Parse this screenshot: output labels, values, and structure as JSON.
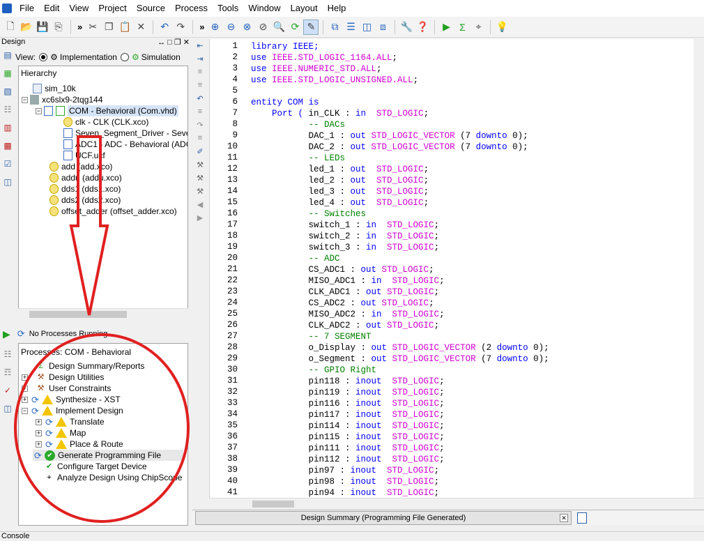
{
  "menu": [
    "File",
    "Edit",
    "View",
    "Project",
    "Source",
    "Process",
    "Tools",
    "Window",
    "Layout",
    "Help"
  ],
  "design_header": "Design",
  "view": {
    "label": "View:",
    "implementation": "Implementation",
    "simulation": "Simulation"
  },
  "hierarchy": {
    "title": "Hierarchy",
    "items": [
      "sim_10k",
      "xc6slx9-2tqg144",
      "COM - Behavioral (Com.vhd)",
      "clk - CLK (CLK.xco)",
      "Seven_Segment_Driver - Sever",
      "ADC1 - ADC - Behavioral (ADC",
      "UCF.ucf",
      "add (add.xco)",
      "addu (addu.xco)",
      "dds1 (dds1.xco)",
      "dds2 (dds2.xco)",
      "offset_adder (offset_adder.xco)"
    ]
  },
  "process_status": "No Processes Running",
  "processes": {
    "title": "Processes: COM - Behavioral",
    "items": [
      "Design Summary/Reports",
      "Design Utilities",
      "User Constraints",
      "Synthesize - XST",
      "Implement Design",
      "Translate",
      "Map",
      "Place & Route",
      "Generate Programming File",
      "Configure Target Device",
      "Analyze Design Using ChipScope"
    ]
  },
  "code_lines": [
    [
      {
        "t": "library IEEE;",
        "c": "kw"
      }
    ],
    [
      {
        "t": "use ",
        "c": "kw"
      },
      {
        "t": "IEEE.STD_LOGIC_1164.ALL",
        "c": "ty"
      },
      {
        "t": ";",
        "c": "tx"
      }
    ],
    [
      {
        "t": "use ",
        "c": "kw"
      },
      {
        "t": "IEEE.NUMERIC_STD.ALL",
        "c": "ty"
      },
      {
        "t": ";",
        "c": "tx"
      }
    ],
    [
      {
        "t": "use ",
        "c": "kw"
      },
      {
        "t": "IEEE.STD_LOGIC_UNSIGNED.ALL",
        "c": "ty"
      },
      {
        "t": ";",
        "c": "tx"
      }
    ],
    [
      {
        "t": "",
        "c": "tx"
      }
    ],
    [
      {
        "t": "entity COM is",
        "c": "kw"
      }
    ],
    [
      {
        "t": "    Port ( ",
        "c": "kw"
      },
      {
        "t": "in_CLK : ",
        "c": "tx"
      },
      {
        "t": "in  ",
        "c": "kw"
      },
      {
        "t": "STD_LOGIC",
        "c": "ty"
      },
      {
        "t": ";",
        "c": "tx"
      }
    ],
    [
      {
        "t": "           -- DACs",
        "c": "cm"
      }
    ],
    [
      {
        "t": "           DAC_1 : ",
        "c": "tx"
      },
      {
        "t": "out ",
        "c": "kw"
      },
      {
        "t": "STD_LOGIC_VECTOR ",
        "c": "ty"
      },
      {
        "t": "(7 ",
        "c": "tx"
      },
      {
        "t": "downto",
        "c": "kw"
      },
      {
        "t": " 0);",
        "c": "tx"
      }
    ],
    [
      {
        "t": "           DAC_2 : ",
        "c": "tx"
      },
      {
        "t": "out ",
        "c": "kw"
      },
      {
        "t": "STD_LOGIC_VECTOR ",
        "c": "ty"
      },
      {
        "t": "(7 ",
        "c": "tx"
      },
      {
        "t": "downto",
        "c": "kw"
      },
      {
        "t": " 0);",
        "c": "tx"
      }
    ],
    [
      {
        "t": "           -- LEDs",
        "c": "cm"
      }
    ],
    [
      {
        "t": "           led_1 : ",
        "c": "tx"
      },
      {
        "t": "out  ",
        "c": "kw"
      },
      {
        "t": "STD_LOGIC",
        "c": "ty"
      },
      {
        "t": ";",
        "c": "tx"
      }
    ],
    [
      {
        "t": "           led_2 : ",
        "c": "tx"
      },
      {
        "t": "out  ",
        "c": "kw"
      },
      {
        "t": "STD_LOGIC",
        "c": "ty"
      },
      {
        "t": ";",
        "c": "tx"
      }
    ],
    [
      {
        "t": "           led_3 : ",
        "c": "tx"
      },
      {
        "t": "out  ",
        "c": "kw"
      },
      {
        "t": "STD_LOGIC",
        "c": "ty"
      },
      {
        "t": ";",
        "c": "tx"
      }
    ],
    [
      {
        "t": "           led_4 : ",
        "c": "tx"
      },
      {
        "t": "out  ",
        "c": "kw"
      },
      {
        "t": "STD_LOGIC",
        "c": "ty"
      },
      {
        "t": ";",
        "c": "tx"
      }
    ],
    [
      {
        "t": "           -- Switches",
        "c": "cm"
      }
    ],
    [
      {
        "t": "           switch_1 : ",
        "c": "tx"
      },
      {
        "t": "in  ",
        "c": "kw"
      },
      {
        "t": "STD_LOGIC",
        "c": "ty"
      },
      {
        "t": ";",
        "c": "tx"
      }
    ],
    [
      {
        "t": "           switch_2 : ",
        "c": "tx"
      },
      {
        "t": "in  ",
        "c": "kw"
      },
      {
        "t": "STD_LOGIC",
        "c": "ty"
      },
      {
        "t": ";",
        "c": "tx"
      }
    ],
    [
      {
        "t": "           switch_3 : ",
        "c": "tx"
      },
      {
        "t": "in  ",
        "c": "kw"
      },
      {
        "t": "STD_LOGIC",
        "c": "ty"
      },
      {
        "t": ";",
        "c": "tx"
      }
    ],
    [
      {
        "t": "           -- ADC",
        "c": "cm"
      }
    ],
    [
      {
        "t": "           CS_ADC1 : ",
        "c": "tx"
      },
      {
        "t": "out ",
        "c": "kw"
      },
      {
        "t": "STD_LOGIC",
        "c": "ty"
      },
      {
        "t": ";",
        "c": "tx"
      }
    ],
    [
      {
        "t": "           MISO_ADC1 : ",
        "c": "tx"
      },
      {
        "t": "in  ",
        "c": "kw"
      },
      {
        "t": "STD_LOGIC",
        "c": "ty"
      },
      {
        "t": ";",
        "c": "tx"
      }
    ],
    [
      {
        "t": "           CLK_ADC1 : ",
        "c": "tx"
      },
      {
        "t": "out ",
        "c": "kw"
      },
      {
        "t": "STD_LOGIC",
        "c": "ty"
      },
      {
        "t": ";",
        "c": "tx"
      }
    ],
    [
      {
        "t": "           CS_ADC2 : ",
        "c": "tx"
      },
      {
        "t": "out ",
        "c": "kw"
      },
      {
        "t": "STD_LOGIC",
        "c": "ty"
      },
      {
        "t": ";",
        "c": "tx"
      }
    ],
    [
      {
        "t": "           MISO_ADC2 : ",
        "c": "tx"
      },
      {
        "t": "in  ",
        "c": "kw"
      },
      {
        "t": "STD_LOGIC",
        "c": "ty"
      },
      {
        "t": ";",
        "c": "tx"
      }
    ],
    [
      {
        "t": "           CLK_ADC2 : ",
        "c": "tx"
      },
      {
        "t": "out ",
        "c": "kw"
      },
      {
        "t": "STD_LOGIC",
        "c": "ty"
      },
      {
        "t": ";",
        "c": "tx"
      }
    ],
    [
      {
        "t": "           -- 7 SEGMENT",
        "c": "cm"
      }
    ],
    [
      {
        "t": "           o_Display : ",
        "c": "tx"
      },
      {
        "t": "out ",
        "c": "kw"
      },
      {
        "t": "STD_LOGIC_VECTOR ",
        "c": "ty"
      },
      {
        "t": "(2 ",
        "c": "tx"
      },
      {
        "t": "downto",
        "c": "kw"
      },
      {
        "t": " 0);",
        "c": "tx"
      }
    ],
    [
      {
        "t": "           o_Segment : ",
        "c": "tx"
      },
      {
        "t": "out ",
        "c": "kw"
      },
      {
        "t": "STD_LOGIC_VECTOR ",
        "c": "ty"
      },
      {
        "t": "(7 ",
        "c": "tx"
      },
      {
        "t": "downto",
        "c": "kw"
      },
      {
        "t": " 0);",
        "c": "tx"
      }
    ],
    [
      {
        "t": "           -- GPIO Right",
        "c": "cm"
      }
    ],
    [
      {
        "t": "           pin118 : ",
        "c": "tx"
      },
      {
        "t": "inout  ",
        "c": "kw"
      },
      {
        "t": "STD_LOGIC",
        "c": "ty"
      },
      {
        "t": ";",
        "c": "tx"
      }
    ],
    [
      {
        "t": "           pin119 : ",
        "c": "tx"
      },
      {
        "t": "inout  ",
        "c": "kw"
      },
      {
        "t": "STD_LOGIC",
        "c": "ty"
      },
      {
        "t": ";",
        "c": "tx"
      }
    ],
    [
      {
        "t": "           pin116 : ",
        "c": "tx"
      },
      {
        "t": "inout  ",
        "c": "kw"
      },
      {
        "t": "STD_LOGIC",
        "c": "ty"
      },
      {
        "t": ";",
        "c": "tx"
      }
    ],
    [
      {
        "t": "           pin117 : ",
        "c": "tx"
      },
      {
        "t": "inout  ",
        "c": "kw"
      },
      {
        "t": "STD_LOGIC",
        "c": "ty"
      },
      {
        "t": ";",
        "c": "tx"
      }
    ],
    [
      {
        "t": "           pin114 : ",
        "c": "tx"
      },
      {
        "t": "inout  ",
        "c": "kw"
      },
      {
        "t": "STD_LOGIC",
        "c": "ty"
      },
      {
        "t": ";",
        "c": "tx"
      }
    ],
    [
      {
        "t": "           pin115 : ",
        "c": "tx"
      },
      {
        "t": "inout  ",
        "c": "kw"
      },
      {
        "t": "STD_LOGIC",
        "c": "ty"
      },
      {
        "t": ";",
        "c": "tx"
      }
    ],
    [
      {
        "t": "           pin111 : ",
        "c": "tx"
      },
      {
        "t": "inout  ",
        "c": "kw"
      },
      {
        "t": "STD_LOGIC",
        "c": "ty"
      },
      {
        "t": ";",
        "c": "tx"
      }
    ],
    [
      {
        "t": "           pin112 : ",
        "c": "tx"
      },
      {
        "t": "inout  ",
        "c": "kw"
      },
      {
        "t": "STD_LOGIC",
        "c": "ty"
      },
      {
        "t": ";",
        "c": "tx"
      }
    ],
    [
      {
        "t": "           pin97 : ",
        "c": "tx"
      },
      {
        "t": "inout  ",
        "c": "kw"
      },
      {
        "t": "STD_LOGIC",
        "c": "ty"
      },
      {
        "t": ";",
        "c": "tx"
      }
    ],
    [
      {
        "t": "           pin98 : ",
        "c": "tx"
      },
      {
        "t": "inout  ",
        "c": "kw"
      },
      {
        "t": "STD_LOGIC",
        "c": "ty"
      },
      {
        "t": ";",
        "c": "tx"
      }
    ],
    [
      {
        "t": "           pin94 : ",
        "c": "tx"
      },
      {
        "t": "inout  ",
        "c": "kw"
      },
      {
        "t": "STD_LOGIC",
        "c": "ty"
      },
      {
        "t": ";",
        "c": "tx"
      }
    ]
  ],
  "doc_tab": "Design Summary (Programming File Generated)",
  "console": "Console",
  "colors": {
    "keyword": "#0000ff",
    "type": "#d000d0",
    "comment": "#008000",
    "annotation": "#e02020"
  }
}
